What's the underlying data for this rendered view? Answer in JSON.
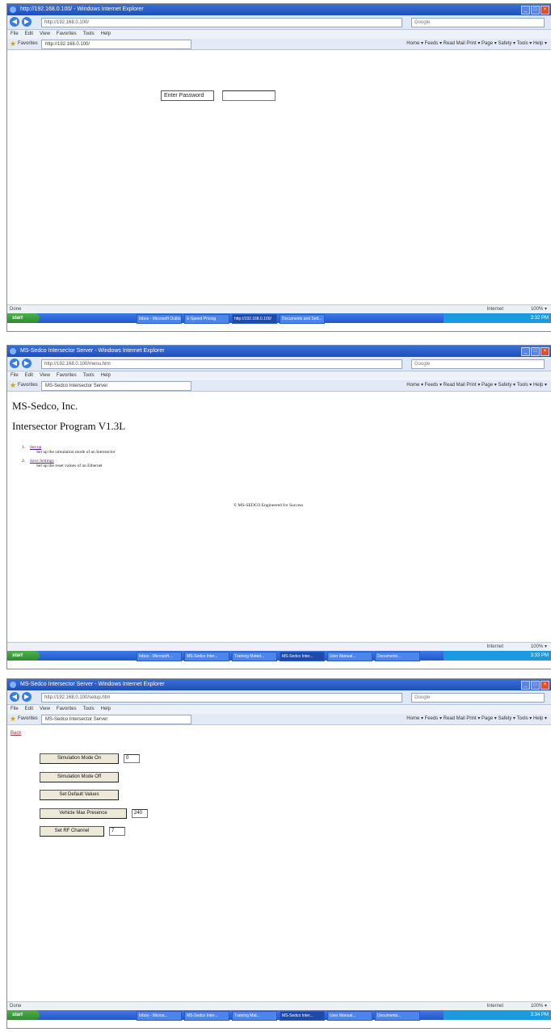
{
  "screens": [
    {
      "window_title": "http://192.168.0.100/ - Windows Internet Explorer",
      "address": "http://192.168.0.100/",
      "search_placeholder": "Google",
      "menus": [
        "File",
        "Edit",
        "View",
        "Favorites",
        "Tools",
        "Help"
      ],
      "favorites_label": "Favorites",
      "tab_title": "http://192.168.0.100/",
      "toolbar_right": "Home ▾  Feeds ▾  Read Mail  Print ▾  Page ▾  Safety ▾  Tools ▾  Help ▾",
      "status_left": "Done",
      "status_zone": "Internet",
      "status_zoom": "100% ▾",
      "start_label": "start",
      "taskbar_items": [
        "Inbox - Microsoft Outlook",
        "E-Speed Pricing",
        "http://192.168.0.100/",
        "Documents and Sett..."
      ],
      "taskbar_active": 2,
      "clock": "3:32 PM",
      "password_label": "Enter Password",
      "password_value": ""
    },
    {
      "window_title": "MS-Sedco Intersector Server - Windows Internet Explorer",
      "address": "http://192.168.0.100/menu.htm",
      "search_placeholder": "Google",
      "menus": [
        "File",
        "Edit",
        "View",
        "Favorites",
        "Tools",
        "Help"
      ],
      "favorites_label": "Favorites",
      "tab_title": "MS-Sedco Intersector Server",
      "toolbar_right": "Home ▾  Feeds ▾  Read Mail  Print ▾  Page ▾  Safety ▾  Tools ▾  Help ▾",
      "status_left": "",
      "status_zone": "Internet",
      "status_zoom": "100% ▾",
      "start_label": "start",
      "taskbar_items": [
        "Inbox - Microsoft...",
        "MS-Sedco Inter...",
        "Training Materi...",
        "MS-Sedco Inter...",
        "User Manual...",
        "Documents..."
      ],
      "taskbar_active": 3,
      "clock": "3:33 PM",
      "company": "MS-Sedco, Inc.",
      "program": "Intersector Program V1.3L",
      "menu_items": [
        {
          "num": "1.",
          "link": "Set-up",
          "desc": "Set up the simulation mode of an Intersector"
        },
        {
          "num": "2.",
          "link": "Save Settings",
          "desc": "Set up the reset values of an Ethernet"
        }
      ],
      "copyright": "© MS-SEDCO Engineered for Success"
    },
    {
      "window_title": "MS-Sedco Intersector Server - Windows Internet Explorer",
      "address": "http://192.168.0.100/setup.htm",
      "search_placeholder": "Google",
      "menus": [
        "File",
        "Edit",
        "View",
        "Favorites",
        "Tools",
        "Help"
      ],
      "favorites_label": "Favorites",
      "tab_title": "MS-Sedco Intersector Server",
      "toolbar_right": "Home ▾  Feeds ▾  Read Mail  Print ▾  Page ▾  Safety ▾  Tools ▾  Help ▾",
      "status_left": "Done",
      "status_zone": "Internet",
      "status_zoom": "100% ▾",
      "start_label": "start",
      "taskbar_items": [
        "Inbox - Micros...",
        "MS-Sedco Inter...",
        "Training Mat...",
        "MS-Sedco Inter...",
        "User Manual...",
        "Documents..."
      ],
      "taskbar_active": 3,
      "clock": "3:34 PM",
      "back_link": "Back",
      "controls": [
        {
          "label": "Simulation Mode On",
          "value": "0"
        },
        {
          "label": "Simulation Mode Off",
          "value": null
        },
        {
          "label": "Set Default Values",
          "value": null
        },
        {
          "label": "Vehicle Max Presence",
          "value": "240"
        },
        {
          "label": "Set RF Channel",
          "value": "7"
        }
      ]
    }
  ]
}
